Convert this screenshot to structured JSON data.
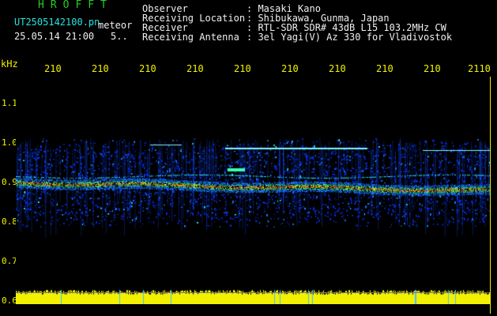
{
  "header": {
    "brand": "HROFFT",
    "filename": "UT2505142100.pn",
    "event_type": "meteor",
    "datetime": "25.05.14 21:00",
    "count": "5..",
    "observer": {
      "label": "Observer",
      "value": ": Masaki Kano"
    },
    "location": {
      "label": "Receiving Location",
      "value": ": Shibukawa, Gunma, Japan"
    },
    "receiver": {
      "label": "Receiver",
      "value": ": RTL-SDR SDR# 43dB L15 103.2MHz CW"
    },
    "antenna": {
      "label": "Receiving Antenna",
      "value": ": 3el Yagi(V) Az 330 for Vladivostok"
    }
  },
  "axis": {
    "y_unit": "kHz",
    "x_ticks": [
      "210",
      "210",
      "210",
      "210",
      "210",
      "210",
      "210",
      "210",
      "210",
      "2110"
    ],
    "y_ticks": [
      "1.1",
      "1.0",
      "0.9",
      "0.8",
      "0.7",
      "0.6"
    ]
  },
  "colors": {
    "label_green": "#1fd11f",
    "label_cyan": "#28e3e3",
    "axis_yellow": "#f2f200",
    "noise_blue": "#0b2fd6",
    "band_red": "#ff3b1f"
  }
}
